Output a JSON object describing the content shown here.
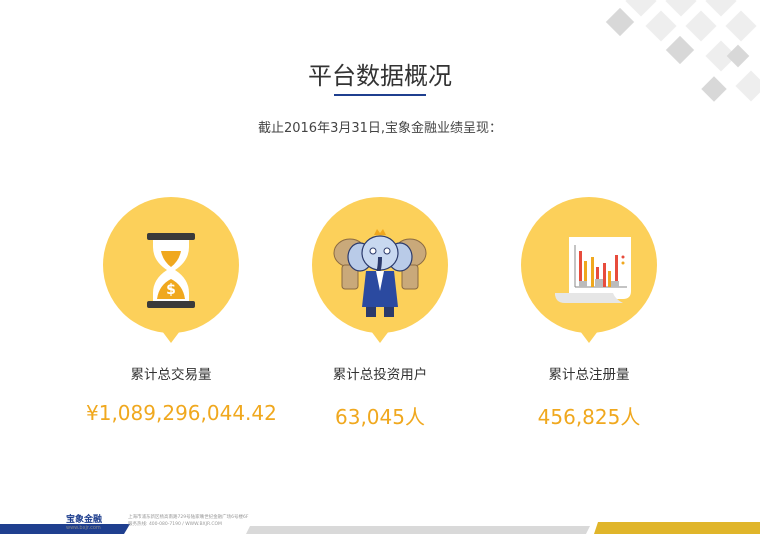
{
  "header": {
    "title": "平台数据概况",
    "subtitle": "截止2016年3月31日,宝象金融业绩呈现："
  },
  "stats": [
    {
      "label": "累计总交易量",
      "value": "¥1,089,296,044.42",
      "icon": "hourglass-dollar-icon"
    },
    {
      "label": "累计总投资用户",
      "value": "63,045人",
      "icon": "elephant-mascot-icon"
    },
    {
      "label": "累计总注册量",
      "value": "456,825人",
      "icon": "chart-paper-icon"
    }
  ],
  "footer": {
    "logo_text": "宝象金融",
    "logo_sub": "www.bxjr.com",
    "address_line1": "上海市浦东新区杨高南路729号陆家嘴世纪金融广场6号楼6F",
    "address_line2": "服务热线: 400-080-7190 / WWW.BXJR.COM"
  },
  "colors": {
    "accent_yellow": "#fcd05a",
    "value_orange": "#f0a81e",
    "navy": "#1f3f8f",
    "gold_band": "#e0b52a"
  }
}
